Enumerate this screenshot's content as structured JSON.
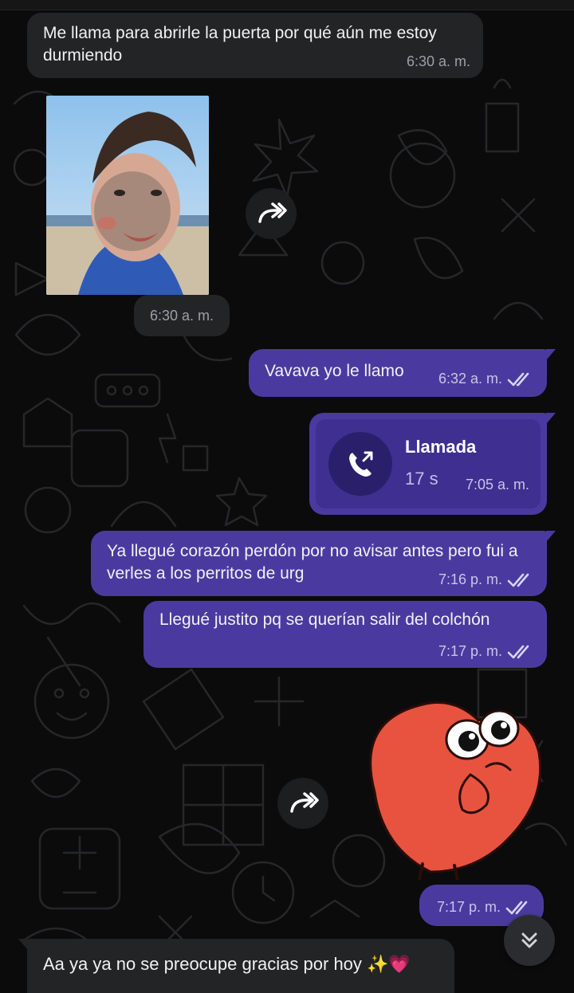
{
  "messages": {
    "m1": {
      "text": "Me llama para abrirle la puerta por qué aún me estoy durmiendo",
      "time": "6:30 a. m."
    },
    "photo": {
      "time": "6:30 a. m."
    },
    "m2": {
      "text": "Vavava yo le llamo",
      "time": "6:32 a. m."
    },
    "call": {
      "title": "Llamada",
      "duration": "17 s",
      "time": "7:05 a. m."
    },
    "m3": {
      "text": "Ya llegué corazón perdón por no avisar antes pero fui a verles a los perritos de urg",
      "time": "7:16 p. m."
    },
    "m4": {
      "text": "Llegué justito pq se querían salir del colchón",
      "time": "7:17 p. m."
    },
    "sticker": {
      "time": "7:17 p. m."
    },
    "m5": {
      "text": "Aa ya ya no se preocupe gracias por hoy ✨💗"
    }
  },
  "icons": {
    "forward": "forward-icon",
    "read": "double-check-icon",
    "call": "outgoing-call-icon",
    "scroll": "double-chevron-down-icon"
  },
  "colors": {
    "outgoing_bubble": "#4a3aa0",
    "incoming_bubble": "#232426",
    "background": "#0b0b0c",
    "tick": "#d7d3f5"
  }
}
